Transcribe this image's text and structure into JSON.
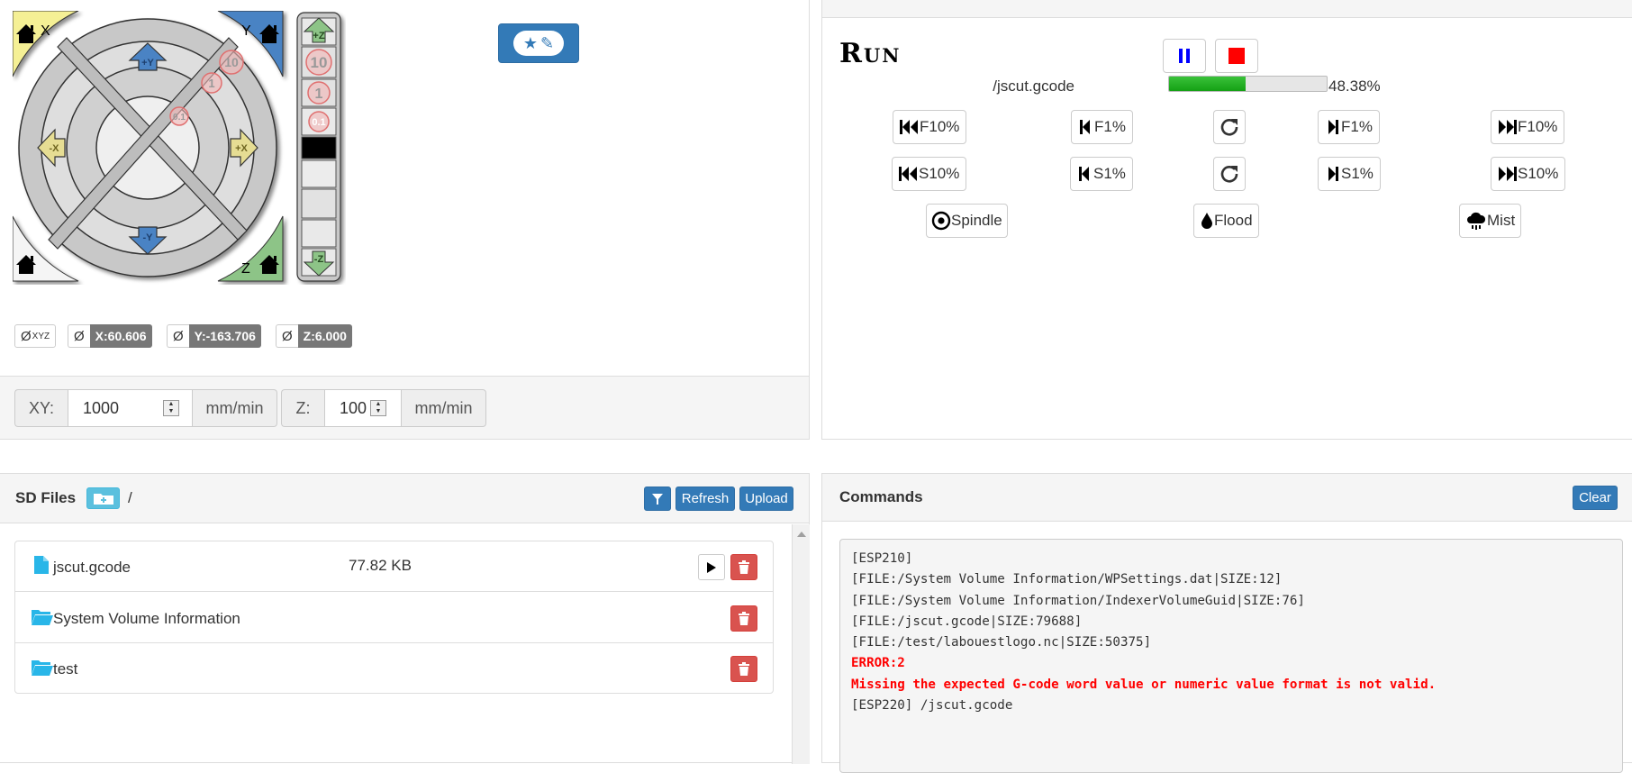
{
  "jog": {
    "home_x": "X",
    "home_y": "Y",
    "home_z": "Z",
    "plus_y": "+Y",
    "minus_y": "-Y",
    "plus_x": "+X",
    "minus_x": "-X",
    "plus_z": "+Z",
    "minus_z": "-Z",
    "ring_steps": [
      "10",
      "1",
      "0.1"
    ],
    "z_steps": [
      "10",
      "1",
      "0.1"
    ],
    "colors": {
      "x": "#f5f095",
      "y": "#4a83c4",
      "z": "#8dc487"
    }
  },
  "macro_button": {
    "icons": [
      "star-icon",
      "pencil-icon"
    ]
  },
  "positions": {
    "zero_all": "Ø",
    "zero_all_sub": "XYZ",
    "zero": "Ø",
    "x": "X:60.606",
    "y": "Y:-163.706",
    "z": "Z:6.000"
  },
  "feedrate": {
    "xy_label": "XY:",
    "xy_value": "1000",
    "xy_unit": "mm/min",
    "z_label": "Z:",
    "z_value": "100",
    "z_unit": "mm/min"
  },
  "run": {
    "title": "Run",
    "file": "/jscut.gcode",
    "progress_percent": 48.38,
    "progress_label": "48.38%",
    "feed_row": [
      "F10%",
      "F1%",
      "F1%",
      "F10%"
    ],
    "speed_row": [
      "S10%",
      "S1%",
      "S1%",
      "S10%"
    ],
    "spindle": "Spindle",
    "flood": "Flood",
    "mist": "Mist",
    "colors": {
      "pause": "#0000ff",
      "stop": "#ff0000",
      "progress": "#22aa22"
    }
  },
  "sd": {
    "title": "SD Files",
    "path": "/",
    "refresh": "Refresh",
    "upload": "Upload",
    "files": [
      {
        "name": "jscut.gcode",
        "size": "77.82 KB",
        "type": "file"
      },
      {
        "name": "System Volume Information",
        "size": "",
        "type": "folder"
      },
      {
        "name": "test",
        "size": "",
        "type": "folder"
      }
    ]
  },
  "commands": {
    "title": "Commands",
    "clear": "Clear",
    "log": [
      {
        "text": "[ESP210]",
        "error": false
      },
      {
        "text": "[FILE:/System Volume Information/WPSettings.dat|SIZE:12]",
        "error": false
      },
      {
        "text": "[FILE:/System Volume Information/IndexerVolumeGuid|SIZE:76]",
        "error": false
      },
      {
        "text": "[FILE:/jscut.gcode|SIZE:79688]",
        "error": false
      },
      {
        "text": "[FILE:/test/labouestlogo.nc|SIZE:50375]",
        "error": false
      },
      {
        "text": "ERROR:2",
        "error": true
      },
      {
        "text": "Missing the expected G-code word value or numeric value format is not valid.",
        "error": true
      },
      {
        "text": "[ESP220] /jscut.gcode",
        "error": false
      }
    ]
  }
}
